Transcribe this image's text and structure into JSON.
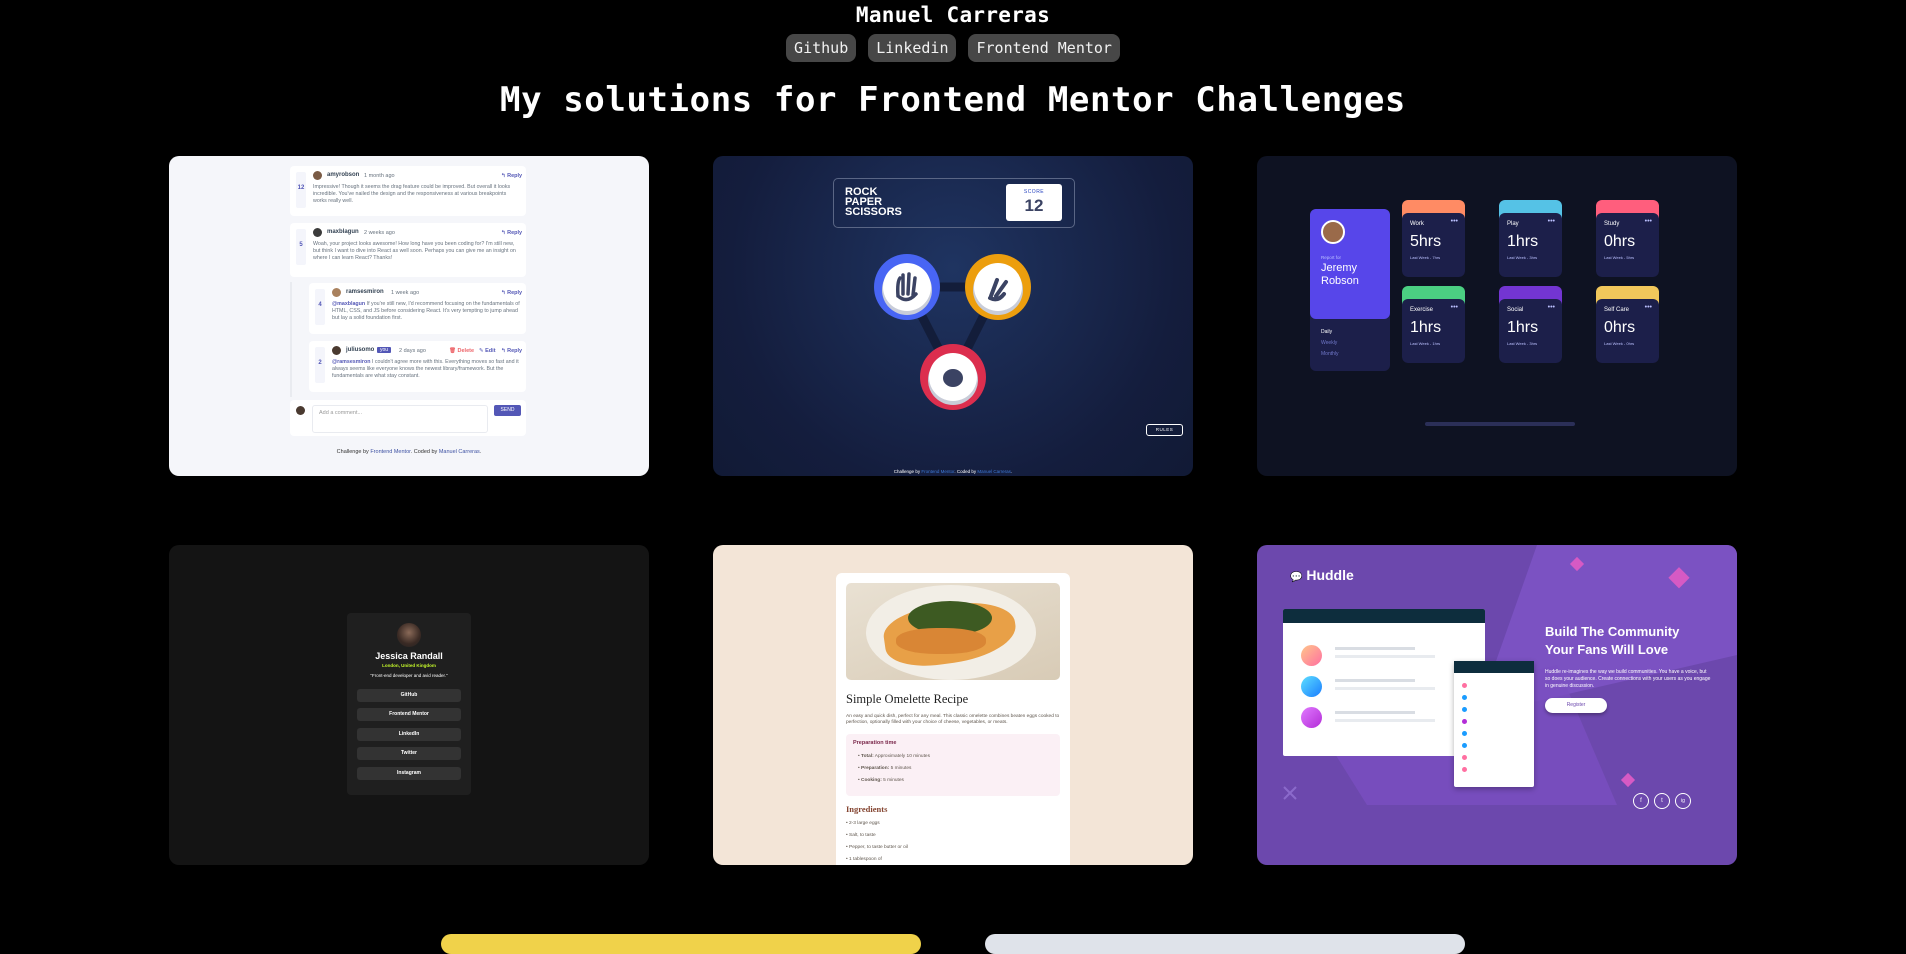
{
  "header": {
    "name": "Manuel Carreras",
    "links": [
      "Github",
      "Linkedin",
      "Frontend Mentor"
    ],
    "title": "My solutions for Frontend Mentor Challenges"
  },
  "comments_card": {
    "comments": [
      {
        "user": "amyrobson",
        "time": "1 month ago",
        "score": "12",
        "reply": "Reply",
        "text": "Impressive! Though it seems the drag feature could be improved. But overall it looks incredible. You've nailed the design and the responsiveness at various breakpoints works really well."
      },
      {
        "user": "maxblagun",
        "time": "2 weeks ago",
        "score": "5",
        "reply": "Reply",
        "text": "Woah, your project looks awesome! How long have you been coding for? I'm still new, but think I want to dive into React as well soon. Perhaps you can give me an insight on where I can learn React? Thanks!"
      },
      {
        "user": "ramsesmiron",
        "time": "1 week ago",
        "score": "4",
        "reply": "Reply",
        "mention": "@maxblagun",
        "text": "If you're still new, I'd recommend focusing on the fundamentals of HTML, CSS, and JS before considering React. It's very tempting to jump ahead but lay a solid foundation first."
      },
      {
        "user": "juliusomo",
        "badge": "you",
        "time": "2 days ago",
        "score": "2",
        "delete": "Delete",
        "edit": "Edit",
        "reply": "Reply",
        "mention": "@ramsesmiron",
        "text": "I couldn't agree more with this. Everything moves so fast and it always seems like everyone knows the newest library/framework. But the fundamentals are what stay constant."
      }
    ],
    "placeholder": "Add a comment...",
    "send": "SEND",
    "footer_prefix": "Challenge by",
    "footer_fm": "Frontend Mentor",
    "footer_mid": ". Coded by",
    "footer_author": "Manuel Carreras",
    "footer_end": "."
  },
  "rps_card": {
    "title_lines": [
      "ROCK",
      "PAPER",
      "SCISSORS"
    ],
    "score_label": "SCORE",
    "score": "12",
    "rules": "RULES",
    "footer_prefix": "Challenge by",
    "footer_fm": "Frontend Mentor",
    "footer_mid": ". Coded by",
    "footer_author": "Manuel Carreras",
    "footer_end": "."
  },
  "tracker_card": {
    "report_for": "Report for",
    "first_name": "Jeremy",
    "last_name": "Robson",
    "periods": [
      "Daily",
      "Weekly",
      "Monthly"
    ],
    "tiles": [
      {
        "label": "Work",
        "value": "5hrs",
        "last": "Last Week - 7hrs",
        "color": "#ff8b64"
      },
      {
        "label": "Play",
        "value": "1hrs",
        "last": "Last Week - 3hrs",
        "color": "#55c2e6"
      },
      {
        "label": "Study",
        "value": "0hrs",
        "last": "Last Week - 5hrs",
        "color": "#ff5e7d"
      },
      {
        "label": "Exercise",
        "value": "1hrs",
        "last": "Last Week - 1hrs",
        "color": "#4bcf82"
      },
      {
        "label": "Social",
        "value": "1hrs",
        "last": "Last Week - 3hrs",
        "color": "#7335d2"
      },
      {
        "label": "Self Care",
        "value": "0hrs",
        "last": "Last Week - 0hrs",
        "color": "#f1c75b"
      }
    ]
  },
  "profile_card": {
    "name": "Jessica Randall",
    "location": "London, United Kingdom",
    "bio": "\"Front-end developer and avid reader.\"",
    "buttons": [
      "GitHub",
      "Frontend Mentor",
      "LinkedIn",
      "Twitter",
      "Instagram"
    ]
  },
  "recipe_card": {
    "title": "Simple Omelette Recipe",
    "intro": "An easy and quick dish, perfect for any meal. This classic omelette combines beaten eggs cooked to perfection, optionally filled with your choice of cheese, vegetables, or meats.",
    "prep_title": "Preparation time",
    "prep": [
      {
        "k": "Total:",
        "v": "Approximately 10 minutes"
      },
      {
        "k": "Preparation:",
        "v": "5 minutes"
      },
      {
        "k": "Cooking:",
        "v": "5 minutes"
      }
    ],
    "ingredients_title": "Ingredients",
    "ingredients": [
      "2-3 large eggs",
      "Salt, to taste",
      "Pepper, to taste butter or oil",
      "1 tablespoon of"
    ]
  },
  "huddle_card": {
    "logo": "Huddle",
    "headline_1": "Build The Community",
    "headline_2": "Your Fans Will Love",
    "body": "Huddle re-imagines the way we build communities. You have a voice, but so does your audience. Create connections with your users as you engage in genuine discussion.",
    "cta": "Register",
    "social": [
      "f",
      "t",
      "ig"
    ]
  }
}
